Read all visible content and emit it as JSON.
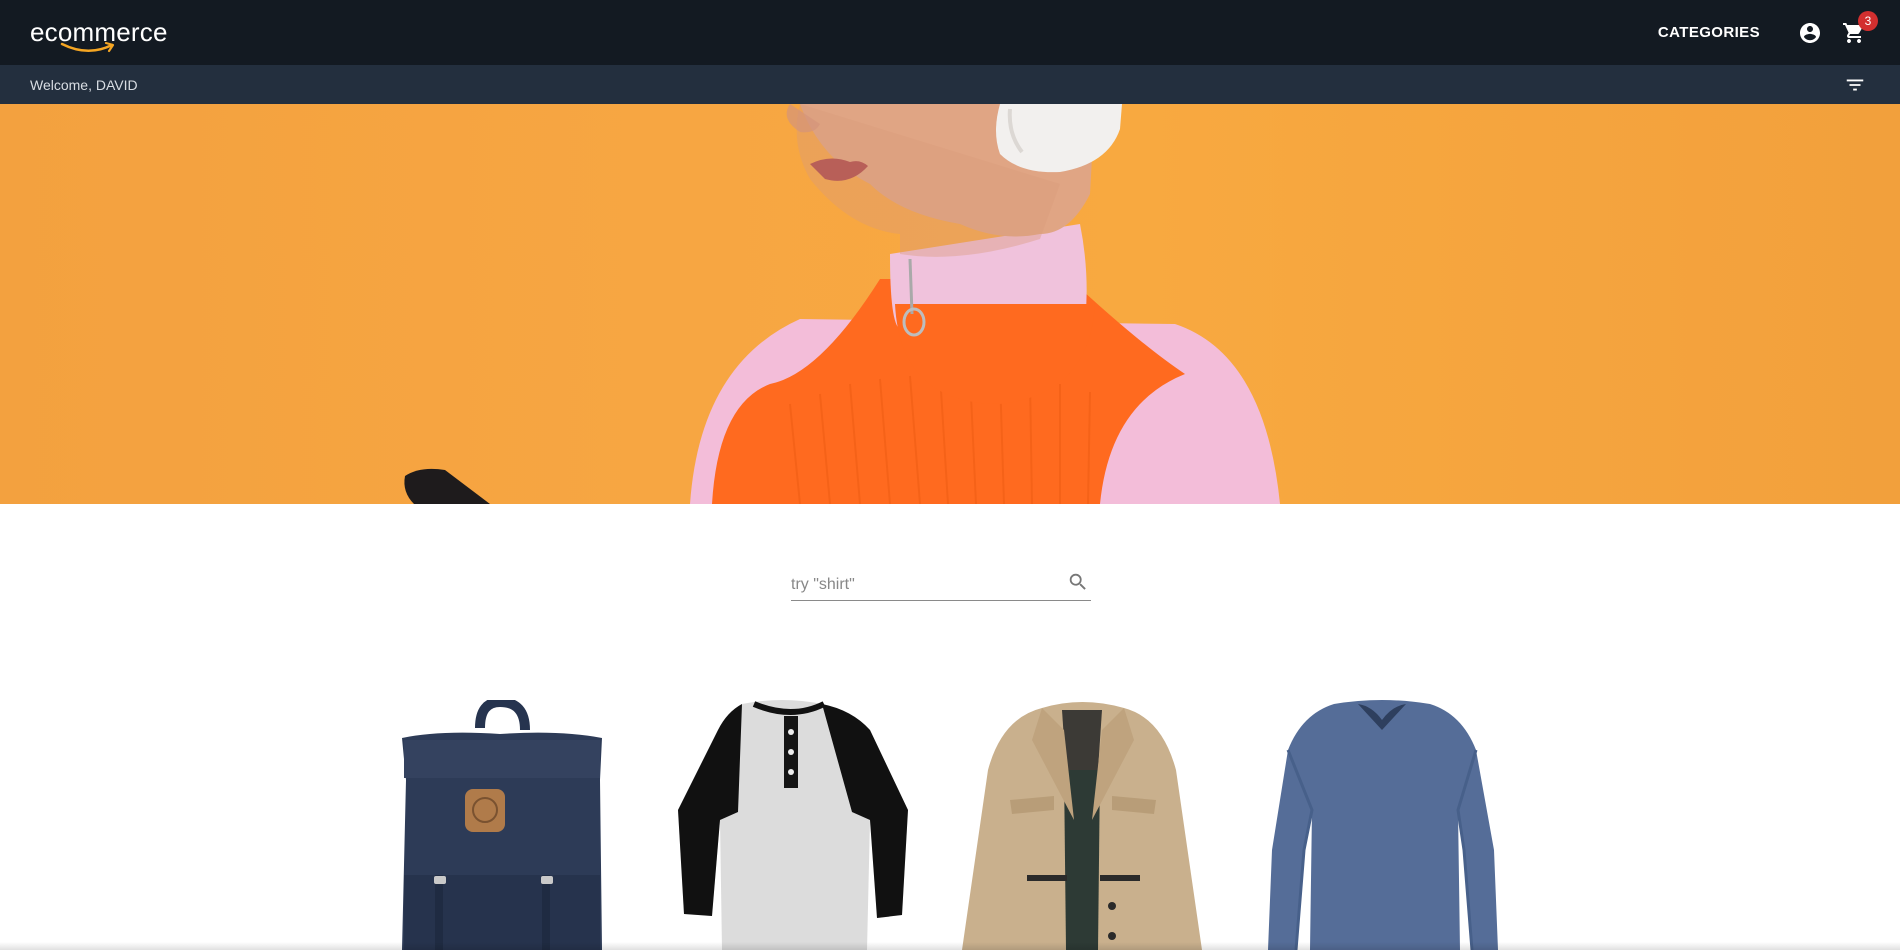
{
  "header": {
    "logo_text": "ecommerce",
    "categories_label": "CATEGORIES",
    "account_icon": "account-circle-icon",
    "cart_icon": "cart-icon",
    "cart_count": "3"
  },
  "subheader": {
    "welcome_text": "Welcome, DAVID",
    "filter_icon": "filter-icon"
  },
  "search": {
    "placeholder": "try \"shirt\"",
    "value": "",
    "icon": "search-icon"
  },
  "products": [
    {
      "image": "backpack"
    },
    {
      "image": "henley-shirt"
    },
    {
      "image": "jacket"
    },
    {
      "image": "long-sleeve-shirt"
    }
  ],
  "colors": {
    "topbar": "#131a22",
    "subbar": "#232f3e",
    "hero_bg": "#f7a642",
    "badge": "#d32f2f",
    "logo_smile": "#f5a623"
  }
}
